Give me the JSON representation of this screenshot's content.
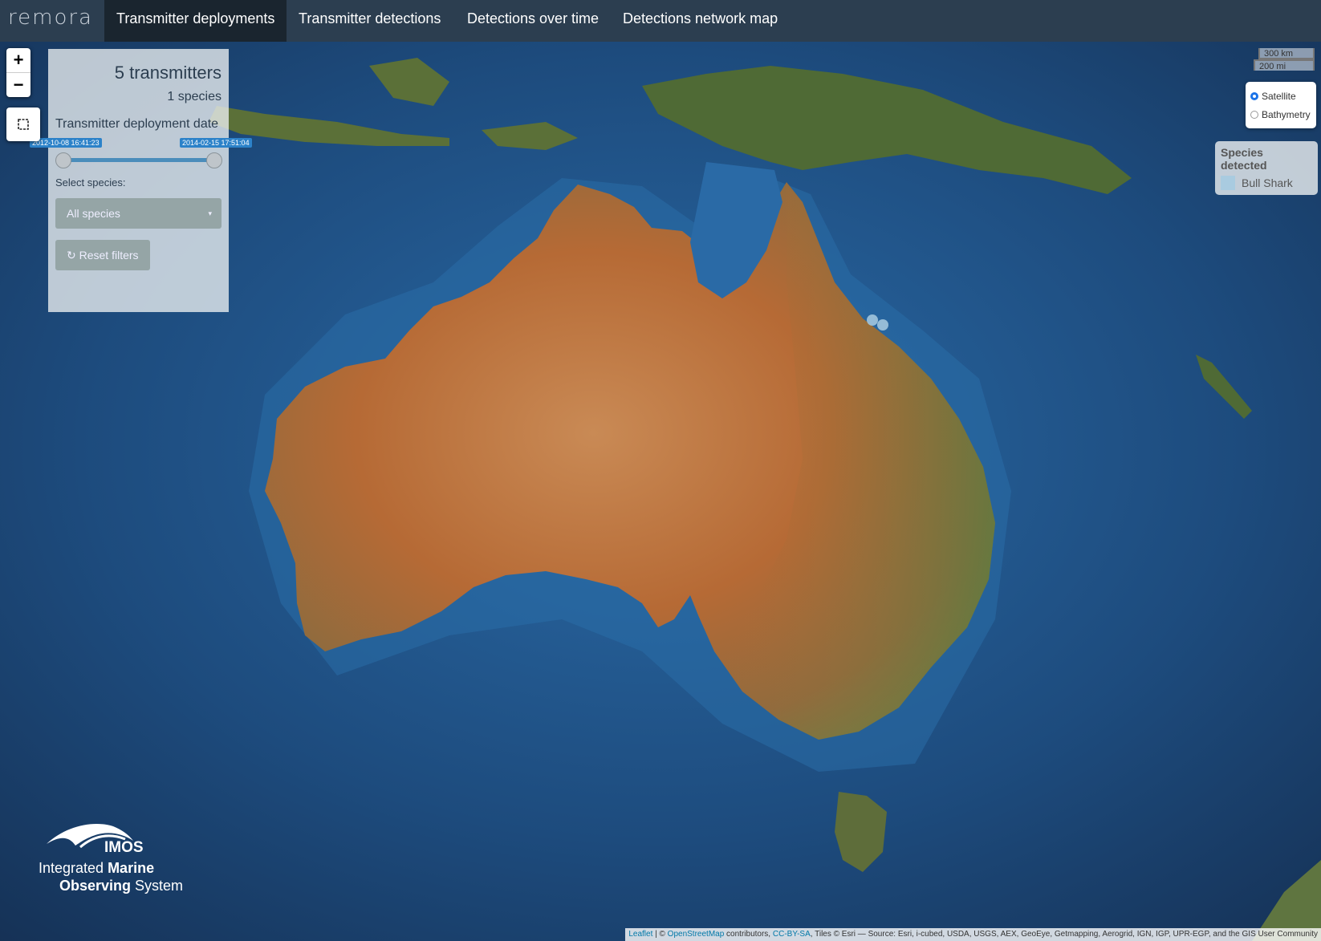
{
  "app": {
    "brand": "remora"
  },
  "nav": {
    "tabs": [
      {
        "label": "Transmitter deployments",
        "active": true
      },
      {
        "label": "Transmitter detections"
      },
      {
        "label": "Detections over time"
      },
      {
        "label": "Detections network map"
      }
    ]
  },
  "map_controls": {
    "zoom_in": "+",
    "zoom_out": "−",
    "scale_km": "300 km",
    "scale_mi": "200 mi"
  },
  "panel": {
    "transmitter_count": "5 transmitters",
    "species_count": "1 species",
    "date_label": "Transmitter deployment date",
    "date_min": "2012-10-08 16:41:23",
    "date_max": "2014-02-15 17:51:04",
    "select_label": "Select species:",
    "select_value": "All species",
    "reset_label": "Reset filters"
  },
  "layers": {
    "options": [
      {
        "label": "Satellite",
        "selected": true
      },
      {
        "label": "Bathymetry",
        "selected": false
      }
    ]
  },
  "legend": {
    "title": "Species detected",
    "items": [
      {
        "label": "Bull Shark",
        "color": "#a9cbe0"
      }
    ]
  },
  "logo": {
    "acronym": "IMOS",
    "line1_a": "Integrated ",
    "line1_b": "Marine",
    "line2_a": "Observing",
    "line2_b": " System"
  },
  "attribution": {
    "leaflet": "Leaflet",
    "sep1": " | © ",
    "osm": "OpenStreetMap",
    "contrib": " contributors, ",
    "license": "CC-BY-SA",
    "tiles": ", Tiles © Esri — Source: Esri, i-cubed, USDA, USGS, AEX, GeoEye, Getmapping, Aerogrid, IGN, IGP, UPR-EGP, and the GIS User Community"
  },
  "colors": {
    "navbar": "#2c3e50",
    "ocean": "#1c4a78",
    "land": "#b86e3a"
  }
}
